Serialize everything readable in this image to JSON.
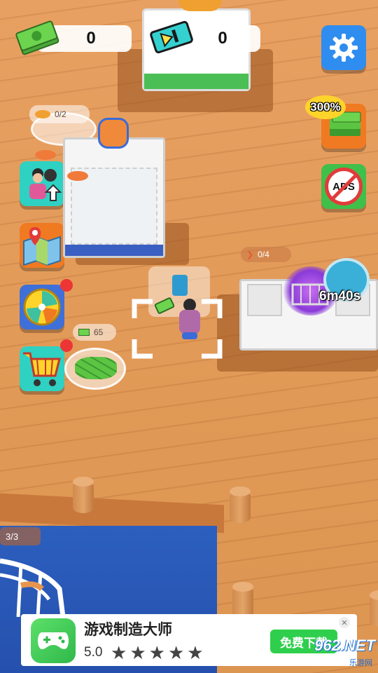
{
  "hud": {
    "cash_value": "0",
    "ticket_value": "0",
    "icons": [
      "cash-stack-icon",
      "ticket-icon",
      "gear-icon"
    ]
  },
  "side_buttons": {
    "upgrade": {
      "icon": "chef-upgrade-icon"
    },
    "map": {
      "icon": "map-pin-icon"
    },
    "spin": {
      "icon": "spin-wheel-icon"
    },
    "shop": {
      "icon": "shopping-cart-icon"
    },
    "boost": {
      "label": "300%",
      "icon": "cash-boost-icon"
    },
    "no_ads": {
      "label": "ADS",
      "icon": "no-ads-icon"
    }
  },
  "stations": {
    "fish_tray_count": "0/2",
    "grill_count": "0/4",
    "cooldown_timer": "6m40s",
    "cash_pile_value": "65",
    "boat_capacity": "3/3"
  },
  "ad_banner": {
    "title": "游戏制造大师",
    "rating": "5.0",
    "stars": 5,
    "download_label": "免费下载",
    "watermark": "962.NET",
    "watermark_sub": "乐游网"
  },
  "colors": {
    "deck": "#e29a58",
    "water": "#2c5fbf",
    "accent_blue": "#2f8df0",
    "accent_green": "#40c04a",
    "accent_orange": "#f07a22"
  }
}
